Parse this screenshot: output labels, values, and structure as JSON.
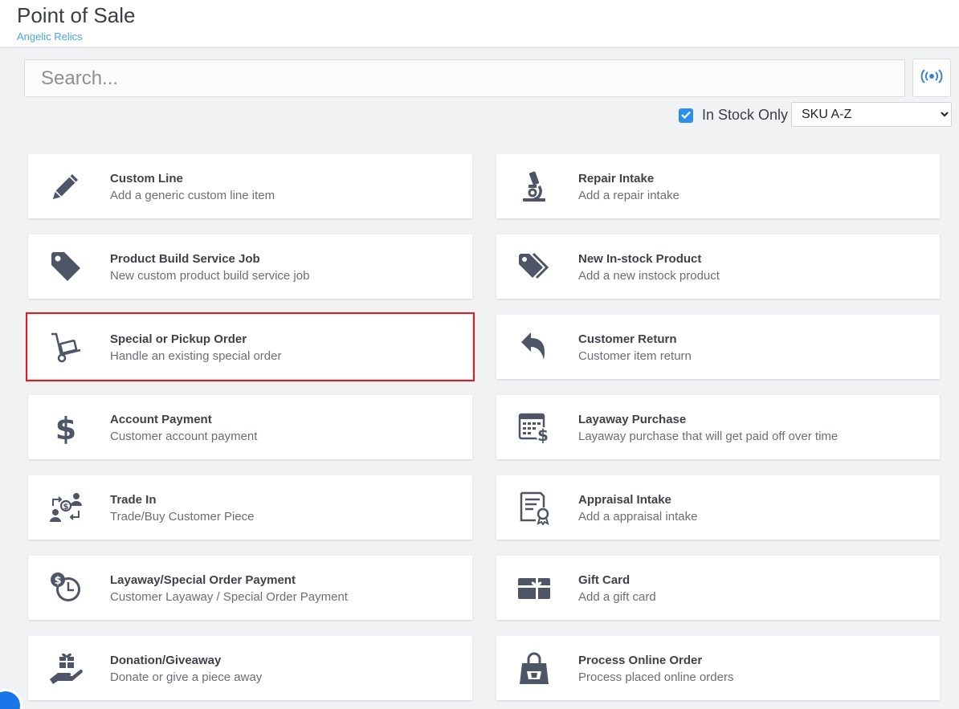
{
  "header": {
    "title": "Point of Sale",
    "store_name": "Angelic Relics"
  },
  "search": {
    "placeholder": "Search...",
    "value": ""
  },
  "filters": {
    "in_stock_only_label": "In Stock Only",
    "in_stock_only_checked": true,
    "sort_selected": "SKU A-Z",
    "sort_options": [
      "SKU A-Z"
    ]
  },
  "actions": [
    {
      "title": "Custom Line",
      "description": "Add a generic custom line item",
      "icon": "pencil-icon"
    },
    {
      "title": "Repair Intake",
      "description": "Add a repair intake",
      "icon": "microscope-icon"
    },
    {
      "title": "Product Build Service Job",
      "description": "New custom product build service job",
      "icon": "tag-icon"
    },
    {
      "title": "New In-stock Product",
      "description": "Add a new instock product",
      "icon": "tags-icon"
    },
    {
      "title": "Special or Pickup Order",
      "description": "Handle an existing special order",
      "icon": "hand-truck-icon"
    },
    {
      "title": "Customer Return",
      "description": "Customer item return",
      "icon": "reply-arrow-icon"
    },
    {
      "title": "Account Payment",
      "description": "Customer account payment",
      "icon": "dollar-sign-icon"
    },
    {
      "title": "Layaway Purchase",
      "description": "Layaway purchase that will get paid off over time",
      "icon": "calendar-dollar-icon"
    },
    {
      "title": "Trade In",
      "description": "Trade/Buy Customer Piece",
      "icon": "trade-exchange-icon"
    },
    {
      "title": "Appraisal Intake",
      "description": "Add a appraisal intake",
      "icon": "certificate-icon"
    },
    {
      "title": "Layaway/Special Order Payment",
      "description": "Customer Layaway / Special Order Payment",
      "icon": "clock-dollar-icon"
    },
    {
      "title": "Gift Card",
      "description": "Add a gift card",
      "icon": "gift-card-icon"
    },
    {
      "title": "Donation/Giveaway",
      "description": "Donate or give a piece away",
      "icon": "hand-gift-icon"
    },
    {
      "title": "Process Online Order",
      "description": "Process placed online orders",
      "icon": "shopping-bag-icon"
    }
  ],
  "colors": {
    "accent": "#2a8ff0",
    "subtitle": "#4aa3e6",
    "icon": "#4d5566",
    "selection_outline": "#e01b1b"
  }
}
